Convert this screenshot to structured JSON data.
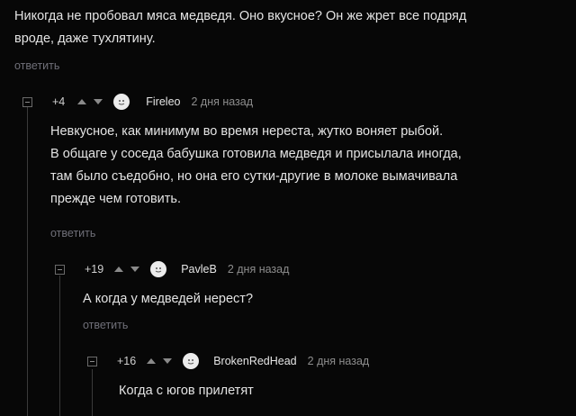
{
  "top_comment": {
    "text_line1": "Никогда не пробовал мяса медведя. Оно вкусное? Он же жрет все подряд",
    "text_line2": "вроде, даже тухлятину.",
    "reply_label": "ответить"
  },
  "comment1": {
    "rating": "+4",
    "username": "Fireleo",
    "time": "2 дня назад",
    "lines": [
      "Невкусное, как минимум во время нереста, жутко воняет рыбой.",
      "В общаге у соседа бабушка готовила медведя и присылала иногда,",
      "там было съедобно, но она его сутки-другие в молоке вымачивала",
      "прежде чем готовить."
    ],
    "reply_label": "ответить"
  },
  "comment2": {
    "rating": "+19",
    "username": "PavleB",
    "time": "2 дня назад",
    "text": "А когда у медведей нерест?",
    "reply_label": "ответить"
  },
  "comment3": {
    "rating": "+16",
    "username": "BrokenRedHead",
    "time": "2 дня назад",
    "text": "Когда с югов прилетят"
  },
  "colors": {
    "background": "#070707",
    "text": "#e4e4e4",
    "muted": "#8d8d8d",
    "reply": "#6f6f78"
  }
}
